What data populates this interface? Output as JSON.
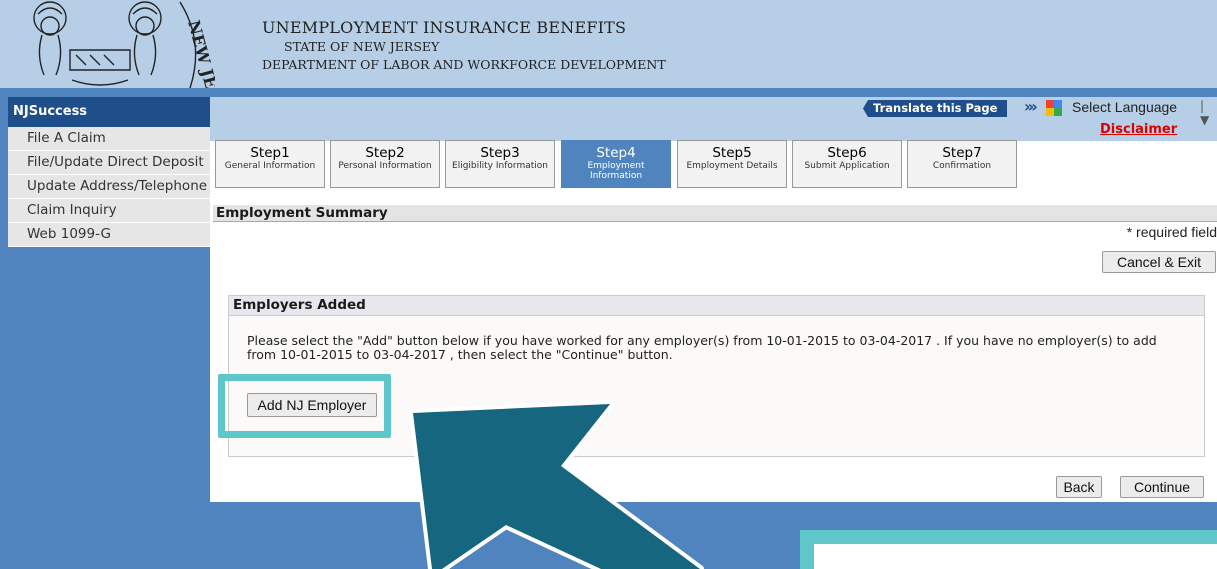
{
  "header": {
    "line1": "UNEMPLOYMENT INSURANCE BENEFITS",
    "line2": "STATE OF NEW JERSEY",
    "line3": "DEPARTMENT OF LABOR AND WORKFORCE DEVELOPMENT",
    "seal_icon": "nj-state-seal-icon"
  },
  "sidebar": {
    "title": "NJSuccess",
    "items": [
      {
        "label": "File A Claim"
      },
      {
        "label": "File/Update Direct Deposit"
      },
      {
        "label": "Update Address/Telephone"
      },
      {
        "label": "Claim Inquiry"
      },
      {
        "label": "Web 1099-G"
      }
    ]
  },
  "topbar": {
    "translate_label": "Translate this Page",
    "select_language": "Select Language",
    "disclaimer": "Disclaimer"
  },
  "steps": [
    {
      "name": "Step1",
      "desc": "General Information",
      "active": false
    },
    {
      "name": "Step2",
      "desc": "Personal Information",
      "active": false
    },
    {
      "name": "Step3",
      "desc": "Eligibility Information",
      "active": false
    },
    {
      "name": "Step4",
      "desc": "Employment Information",
      "active": true
    },
    {
      "name": "Step5",
      "desc": "Employment Details",
      "active": false
    },
    {
      "name": "Step6",
      "desc": "Submit Application",
      "active": false
    },
    {
      "name": "Step7",
      "desc": "Confirmation",
      "active": false
    }
  ],
  "main": {
    "section_title": "Employment Summary",
    "required_note": "* required field",
    "cancel_label": "Cancel & Exit",
    "employers": {
      "title": "Employers Added",
      "instructions": "Please select the \"Add\" button below if you have worked for any employer(s) from 10-01-2015 to 03-04-2017 . If you have no employer(s) to add from 10-01-2015 to 03-04-2017 , then select the \"Continue\" button.",
      "add_label": "Add NJ Employer"
    },
    "back_label": "Back",
    "continue_label": "Continue"
  },
  "colors": {
    "accent": "#4f84bf",
    "header_bg": "#b6cfe6",
    "highlight": "#5fc6c9",
    "arrow": "#166680"
  }
}
